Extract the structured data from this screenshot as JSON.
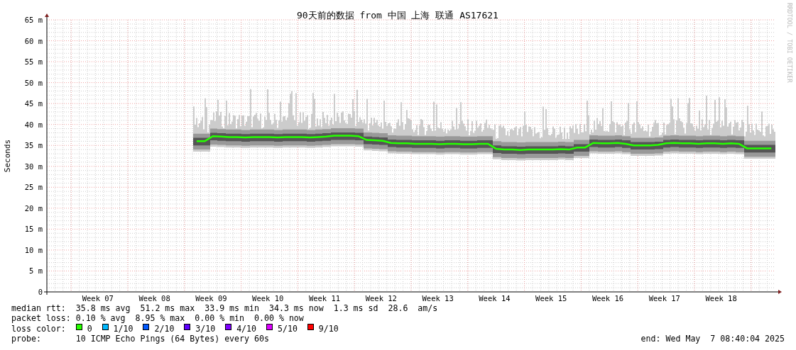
{
  "chart_data": {
    "type": "line",
    "title": "90天前的数据 from 中国 上海 联通 AS17621",
    "ylabel": "Seconds",
    "grid": true,
    "ylim": [
      0,
      65
    ],
    "yticks": [
      {
        "value": 0,
        "label": "0"
      },
      {
        "value": 5,
        "label": "5 m"
      },
      {
        "value": 10,
        "label": "10 m"
      },
      {
        "value": 15,
        "label": "15 m"
      },
      {
        "value": 20,
        "label": "20 m"
      },
      {
        "value": 25,
        "label": "25 m"
      },
      {
        "value": 30,
        "label": "30 m"
      },
      {
        "value": 35,
        "label": "35 m"
      },
      {
        "value": 40,
        "label": "40 m"
      },
      {
        "value": 45,
        "label": "45 m"
      },
      {
        "value": 50,
        "label": "50 m"
      },
      {
        "value": 55,
        "label": "55 m"
      },
      {
        "value": 60,
        "label": "60 m"
      },
      {
        "value": 65,
        "label": "65 m"
      }
    ],
    "categories": [
      null,
      null,
      null,
      null,
      null,
      null,
      "Week 07",
      null,
      null,
      null,
      null,
      null,
      null,
      "Week 08",
      null,
      null,
      null,
      null,
      null,
      null,
      "Week 09",
      null,
      null,
      null,
      null,
      null,
      null,
      "Week 10",
      null,
      null,
      null,
      null,
      null,
      null,
      "Week 11",
      null,
      null,
      null,
      null,
      null,
      null,
      "Week 12",
      null,
      null,
      null,
      null,
      null,
      null,
      "Week 13",
      null,
      null,
      null,
      null,
      null,
      null,
      "Week 14",
      null,
      null,
      null,
      null,
      null,
      null,
      "Week 15",
      null,
      null,
      null,
      null,
      null,
      null,
      "Week 16",
      null,
      null,
      null,
      null,
      null,
      null,
      "Week 17",
      null,
      null,
      null,
      null,
      null,
      null,
      "Week 18",
      null,
      null,
      null,
      null,
      null,
      null
    ],
    "series": [
      {
        "color": "#26ff00",
        "values": [
          null,
          null,
          null,
          null,
          null,
          null,
          null,
          null,
          null,
          null,
          null,
          null,
          null,
          null,
          null,
          null,
          null,
          null,
          36.0,
          36.0,
          37.2,
          37.1,
          37.0,
          37.0,
          36.9,
          37.0,
          37.0,
          37.0,
          36.9,
          37.0,
          37.0,
          37.0,
          36.9,
          37.0,
          37.1,
          37.3,
          37.3,
          37.3,
          37.2,
          36.3,
          36.2,
          36.1,
          35.6,
          35.5,
          35.5,
          35.4,
          35.4,
          35.4,
          35.3,
          35.4,
          35.4,
          35.3,
          35.3,
          35.4,
          35.4,
          34.2,
          34.0,
          34.0,
          33.9,
          34.0,
          34.0,
          34.0,
          34.0,
          34.1,
          34.0,
          34.5,
          34.5,
          35.6,
          35.5,
          35.5,
          35.6,
          35.4,
          35.0,
          35.0,
          35.0,
          35.1,
          35.5,
          35.6,
          35.5,
          35.5,
          35.4,
          35.5,
          35.5,
          35.4,
          35.5,
          35.4,
          34.3,
          34.3,
          34.3,
          34.3
        ]
      }
    ]
  },
  "legend": {
    "stats": [
      {
        "label": "median rtt:",
        "items": [
          "35.8 ms avg",
          "51.2 ms max",
          "33.9 ms min",
          "34.3 ms now",
          "1.3 ms sd",
          "28.6",
          "am/s"
        ]
      },
      {
        "label": "packet loss:",
        "items": [
          "0.10 % avg",
          "8.95 % max",
          "0.00 % min",
          "0.00 % now"
        ]
      }
    ],
    "loss_colors": {
      "label": "loss color:",
      "items": [
        {
          "label": "0",
          "color": "#26ff00"
        },
        {
          "label": "1/10",
          "color": "#00b8ff"
        },
        {
          "label": "2/10",
          "color": "#0059ff"
        },
        {
          "label": "3/10",
          "color": "#5e00ff"
        },
        {
          "label": "4/10",
          "color": "#7e00ff"
        },
        {
          "label": "5/10",
          "color": "#dd00ff"
        },
        {
          "label": "9/10",
          "color": "#ff0000"
        }
      ]
    },
    "probe": {
      "label": "probe:",
      "text": "10 ICMP Echo Pings (64 Bytes) every 60s"
    },
    "end": "end: Wed May  7 08:40:04 2025"
  },
  "credit": "RRDTOOL / TOBI OETIKER"
}
